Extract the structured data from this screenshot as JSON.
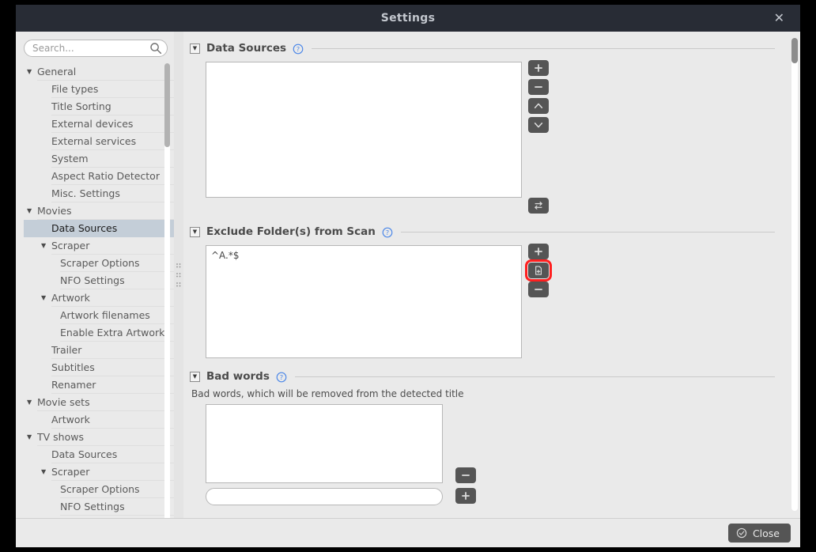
{
  "window": {
    "title": "Settings",
    "close_glyph": "✕"
  },
  "sidebar": {
    "search": {
      "placeholder": "Search...",
      "value": "",
      "icon": "search-icon"
    },
    "items": [
      {
        "label": "General",
        "level": 0,
        "twisty": "▼",
        "selected": false
      },
      {
        "label": "File types",
        "level": 1,
        "twisty": "",
        "selected": false
      },
      {
        "label": "Title Sorting",
        "level": 1,
        "twisty": "",
        "selected": false
      },
      {
        "label": "External devices",
        "level": 1,
        "twisty": "",
        "selected": false
      },
      {
        "label": "External services",
        "level": 1,
        "twisty": "",
        "selected": false
      },
      {
        "label": "System",
        "level": 1,
        "twisty": "",
        "selected": false
      },
      {
        "label": "Aspect Ratio Detector",
        "level": 1,
        "twisty": "",
        "selected": false
      },
      {
        "label": "Misc. Settings",
        "level": 1,
        "twisty": "",
        "selected": false
      },
      {
        "label": "Movies",
        "level": 0,
        "twisty": "▼",
        "selected": false
      },
      {
        "label": "Data Sources",
        "level": 1,
        "twisty": "",
        "selected": true
      },
      {
        "label": "Scraper",
        "level": 1,
        "twisty": "▼",
        "selected": false
      },
      {
        "label": "Scraper Options",
        "level": 2,
        "twisty": "",
        "selected": false
      },
      {
        "label": "NFO Settings",
        "level": 2,
        "twisty": "",
        "selected": false
      },
      {
        "label": "Artwork",
        "level": 1,
        "twisty": "▼",
        "selected": false
      },
      {
        "label": "Artwork filenames",
        "level": 2,
        "twisty": "",
        "selected": false
      },
      {
        "label": "Enable Extra Artwork",
        "level": 2,
        "twisty": "",
        "selected": false
      },
      {
        "label": "Trailer",
        "level": 1,
        "twisty": "",
        "selected": false
      },
      {
        "label": "Subtitles",
        "level": 1,
        "twisty": "",
        "selected": false
      },
      {
        "label": "Renamer",
        "level": 1,
        "twisty": "",
        "selected": false
      },
      {
        "label": "Movie sets",
        "level": 0,
        "twisty": "▼",
        "selected": false
      },
      {
        "label": "Artwork",
        "level": 1,
        "twisty": "",
        "selected": false
      },
      {
        "label": "TV shows",
        "level": 0,
        "twisty": "▼",
        "selected": false
      },
      {
        "label": "Data Sources",
        "level": 1,
        "twisty": "",
        "selected": false
      },
      {
        "label": "Scraper",
        "level": 1,
        "twisty": "▼",
        "selected": false
      },
      {
        "label": "Scraper Options",
        "level": 2,
        "twisty": "",
        "selected": false
      },
      {
        "label": "NFO Settings",
        "level": 2,
        "twisty": "",
        "selected": false
      }
    ]
  },
  "main": {
    "sections": [
      {
        "title": "Data Sources",
        "collapse_glyph": "▼",
        "help": "?",
        "hint": "",
        "entries": [],
        "buttons": [
          {
            "name": "add-data-source-button",
            "icon": "plus-icon",
            "highlighted": false
          },
          {
            "name": "remove-data-source-button",
            "icon": "minus-icon",
            "highlighted": false
          },
          {
            "name": "move-up-button",
            "icon": "chevron-up-icon",
            "highlighted": false
          },
          {
            "name": "move-down-button",
            "icon": "chevron-down-icon",
            "highlighted": false
          }
        ],
        "extra_buttons": [
          {
            "name": "swap-data-source-button",
            "icon": "swap-icon",
            "highlighted": false
          }
        ]
      },
      {
        "title": "Exclude Folder(s) from Scan",
        "collapse_glyph": "▼",
        "help": "?",
        "hint": "",
        "entries": [
          "^A.*$"
        ],
        "buttons": [
          {
            "name": "add-exclude-folder-button",
            "icon": "plus-icon",
            "highlighted": false
          },
          {
            "name": "add-exclude-pattern-file-button",
            "icon": "file-plus-icon",
            "highlighted": true
          },
          {
            "name": "remove-exclude-folder-button",
            "icon": "minus-icon",
            "highlighted": false
          }
        ],
        "extra_buttons": []
      },
      {
        "title": "Bad words",
        "collapse_glyph": "▼",
        "help": "?",
        "hint": "Bad words, which will be removed from the detected title",
        "entries": [],
        "buttons": [],
        "extra_buttons": []
      }
    ],
    "bad_words_remove_button": "minus-icon"
  },
  "bottom": {
    "close_label": "Close",
    "close_icon": "check-circle-icon"
  },
  "colors": {
    "titlebar": "#282c35",
    "body": "#eaeaea",
    "selection": "#c4ced8",
    "button": "#555555",
    "highlight": "#ff1f1f",
    "help_blue": "#4a86e8"
  }
}
